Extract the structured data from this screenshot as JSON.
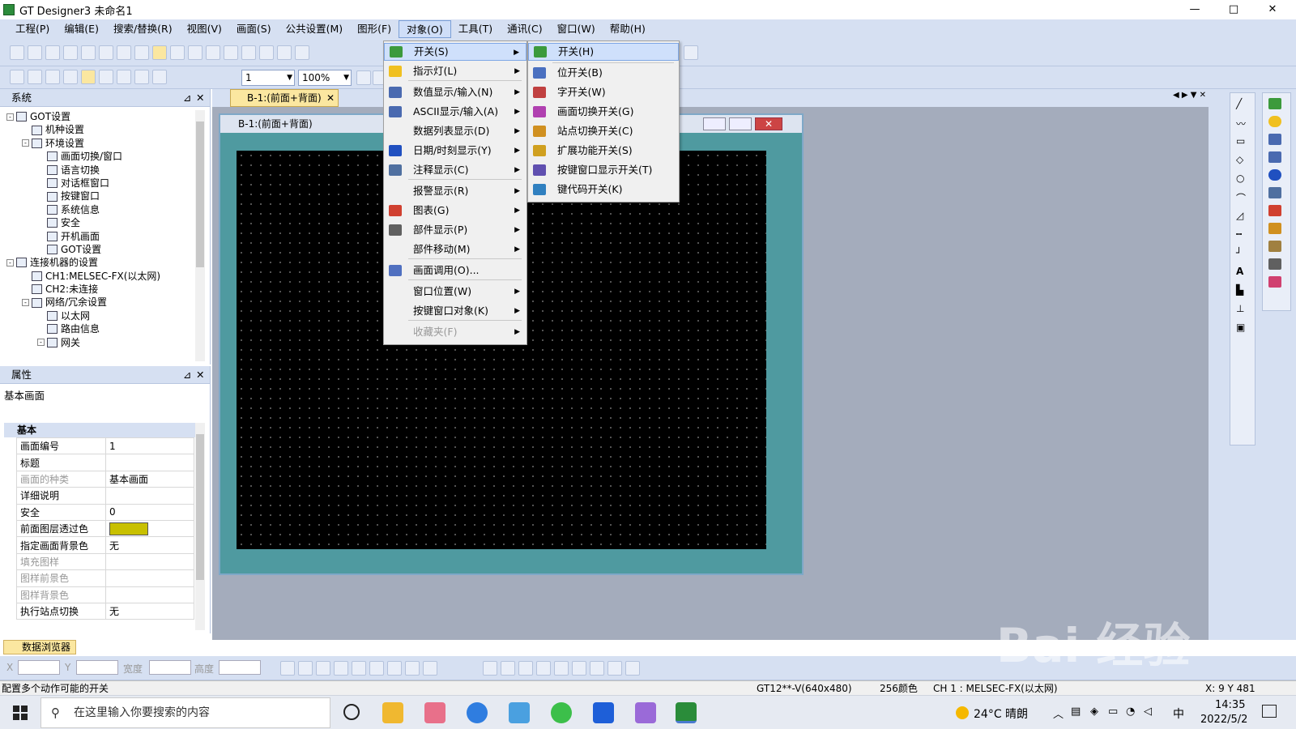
{
  "window": {
    "title": "GT Designer3 未命名1",
    "min": "—",
    "max": "□",
    "close": "✕"
  },
  "menubar": [
    "工程(P)",
    "编辑(E)",
    "搜索/替换(R)",
    "视图(V)",
    "画面(S)",
    "公共设置(M)",
    "图形(F)",
    "对象(O)",
    "工具(T)",
    "通讯(C)",
    "窗口(W)",
    "帮助(H)"
  ],
  "toolbar": {
    "screen_no": "1",
    "zoom": "100%"
  },
  "system_panel": {
    "title": "系统",
    "tree": [
      {
        "label": "GOT设置",
        "lvl": 0,
        "ex": "-"
      },
      {
        "label": "机种设置",
        "lvl": 1
      },
      {
        "label": "环境设置",
        "lvl": 1,
        "ex": "-"
      },
      {
        "label": "画面切换/窗口",
        "lvl": 2
      },
      {
        "label": "语言切换",
        "lvl": 2
      },
      {
        "label": "对话框窗口",
        "lvl": 2
      },
      {
        "label": "按键窗口",
        "lvl": 2
      },
      {
        "label": "系统信息",
        "lvl": 2
      },
      {
        "label": "安全",
        "lvl": 2
      },
      {
        "label": "开机画面",
        "lvl": 2
      },
      {
        "label": "GOT设置",
        "lvl": 2
      },
      {
        "label": "连接机器的设置",
        "lvl": 0,
        "ex": "-"
      },
      {
        "label": "CH1:MELSEC-FX(以太网)",
        "lvl": 1
      },
      {
        "label": "CH2:未连接",
        "lvl": 1
      },
      {
        "label": "网络/冗余设置",
        "lvl": 1,
        "ex": "-"
      },
      {
        "label": "以太网",
        "lvl": 2
      },
      {
        "label": "路由信息",
        "lvl": 2
      },
      {
        "label": "网关",
        "lvl": 2,
        "ex": "-"
      }
    ]
  },
  "props_panel": {
    "title": "属性",
    "subtitle": "基本画面",
    "section": "基本",
    "rows": [
      {
        "k": "画面编号",
        "v": "1"
      },
      {
        "k": "标题",
        "v": ""
      },
      {
        "k": "画面的种类",
        "v": "基本画面",
        "dim": true
      },
      {
        "k": "详细说明",
        "v": ""
      },
      {
        "k": "安全",
        "v": "0"
      },
      {
        "k": "前面图层透过色",
        "v": "",
        "swatch": "#c8c000"
      },
      {
        "k": "指定画面背景色",
        "v": "无"
      },
      {
        "k": "填充图样",
        "v": "",
        "dim": true
      },
      {
        "k": "图样前景色",
        "v": "",
        "dim": true
      },
      {
        "k": "图样背景色",
        "v": "",
        "dim": true
      },
      {
        "k": "执行站点切换",
        "v": "无"
      }
    ]
  },
  "data_browser": {
    "label": "数据浏览器"
  },
  "coord_bar": {
    "x": "X",
    "y": "Y",
    "w": "宽度",
    "h": "高度"
  },
  "doc_tab": {
    "label": "B-1:(前面+背面)"
  },
  "screen_window": {
    "title": "B-1:(前面+背面)"
  },
  "object_menu": {
    "items": [
      {
        "label": "开关(S)",
        "sub": true,
        "hl": true,
        "color": "#3c9a3c"
      },
      {
        "label": "指示灯(L)",
        "sub": true,
        "color": "#f0c020"
      },
      {
        "label": "数值显示/输入(N)",
        "sub": true,
        "color": "#4a6ab0"
      },
      {
        "label": "ASCII显示/输入(A)",
        "sub": true,
        "color": "#4a6ab0"
      },
      {
        "label": "数据列表显示(D)",
        "sub": true,
        "color": ""
      },
      {
        "label": "日期/时刻显示(Y)",
        "sub": true,
        "color": "#2050c0"
      },
      {
        "label": "注释显示(C)",
        "sub": true,
        "color": "#5070a0"
      },
      {
        "label": "报警显示(R)",
        "sub": true,
        "color": ""
      },
      {
        "label": "图表(G)",
        "sub": true,
        "color": "#d04030"
      },
      {
        "label": "部件显示(P)",
        "sub": true,
        "color": "#606060"
      },
      {
        "label": "部件移动(M)",
        "sub": true,
        "color": ""
      },
      {
        "label": "画面调用(O)...",
        "sub": false,
        "color": "#5070c0"
      },
      {
        "label": "窗口位置(W)",
        "sub": true,
        "color": ""
      },
      {
        "label": "按键窗口对象(K)",
        "sub": true,
        "color": ""
      },
      {
        "label": "收藏夹(F)",
        "sub": true,
        "color": "",
        "dim": true
      }
    ]
  },
  "switch_menu": {
    "items": [
      {
        "label": "开关(H)",
        "hl": true,
        "color": "#3c9a3c"
      },
      {
        "label": "位开关(B)",
        "color": "#4a70c0"
      },
      {
        "label": "字开关(W)",
        "color": "#c04040"
      },
      {
        "label": "画面切换开关(G)",
        "color": "#b040b0"
      },
      {
        "label": "站点切换开关(C)",
        "color": "#d09020"
      },
      {
        "label": "扩展功能开关(S)",
        "color": "#d0a020"
      },
      {
        "label": "按键窗口显示开关(T)",
        "color": "#6050b0"
      },
      {
        "label": "键代码开关(K)",
        "color": "#3080c0"
      }
    ]
  },
  "status_bar": {
    "left": "配置多个动作可能的开关",
    "got": "GT12**-V(640x480)",
    "colors": "256颜色",
    "ch": "CH 1 : MELSEC-FX(以太网)",
    "pos": "X: 9 Y 481"
  },
  "taskbar": {
    "search": "在这里输入你要搜索的内容",
    "weather": "24°C 晴朗",
    "time": "14:35",
    "date": "2022/5/2",
    "ime": "中"
  },
  "watermark": {
    "text": "Bai 经验"
  }
}
